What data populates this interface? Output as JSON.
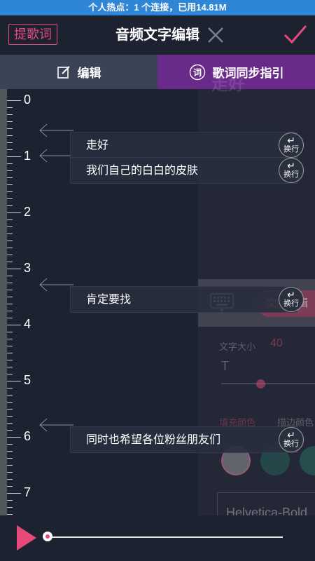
{
  "status_bar": {
    "text": "个人热点：1 个连接，已用14.81M"
  },
  "header": {
    "lyric_button": "提歌词",
    "title": "音频文字编辑"
  },
  "tabs": [
    {
      "label": "编辑",
      "icon": "edit-icon"
    },
    {
      "label": "歌词同步指引",
      "icon": "ci-circle-icon",
      "icon_text": "词"
    }
  ],
  "ruler": {
    "labels": [
      "0",
      "1",
      "2",
      "3",
      "4",
      "5",
      "6",
      "7"
    ]
  },
  "lyrics": [
    {
      "text": "走好",
      "button": "换行"
    },
    {
      "text": "我们自己的白白的皮肤",
      "button": "换行"
    },
    {
      "text": "肯定要找",
      "button": "换行"
    },
    {
      "text": "同时也希望各位粉丝朋友们",
      "button": "换行"
    }
  ],
  "wrap_symbol": "↵",
  "background_panel": {
    "title": "走好",
    "pill_text": "文字编辑",
    "font_size_label": "文字大小",
    "font_size_value": "40",
    "t_label": "T",
    "text_color_label": "填充颜色",
    "stroke_color_label": "描边颜色",
    "font_name": "Helvetica-Bold"
  },
  "colors": {
    "accent": "#e64a7b",
    "status": "#2f86d6",
    "tab_active": "#6a2a8a",
    "tab_inactive": "#3a4456"
  },
  "player": {
    "progress": 0.0
  }
}
